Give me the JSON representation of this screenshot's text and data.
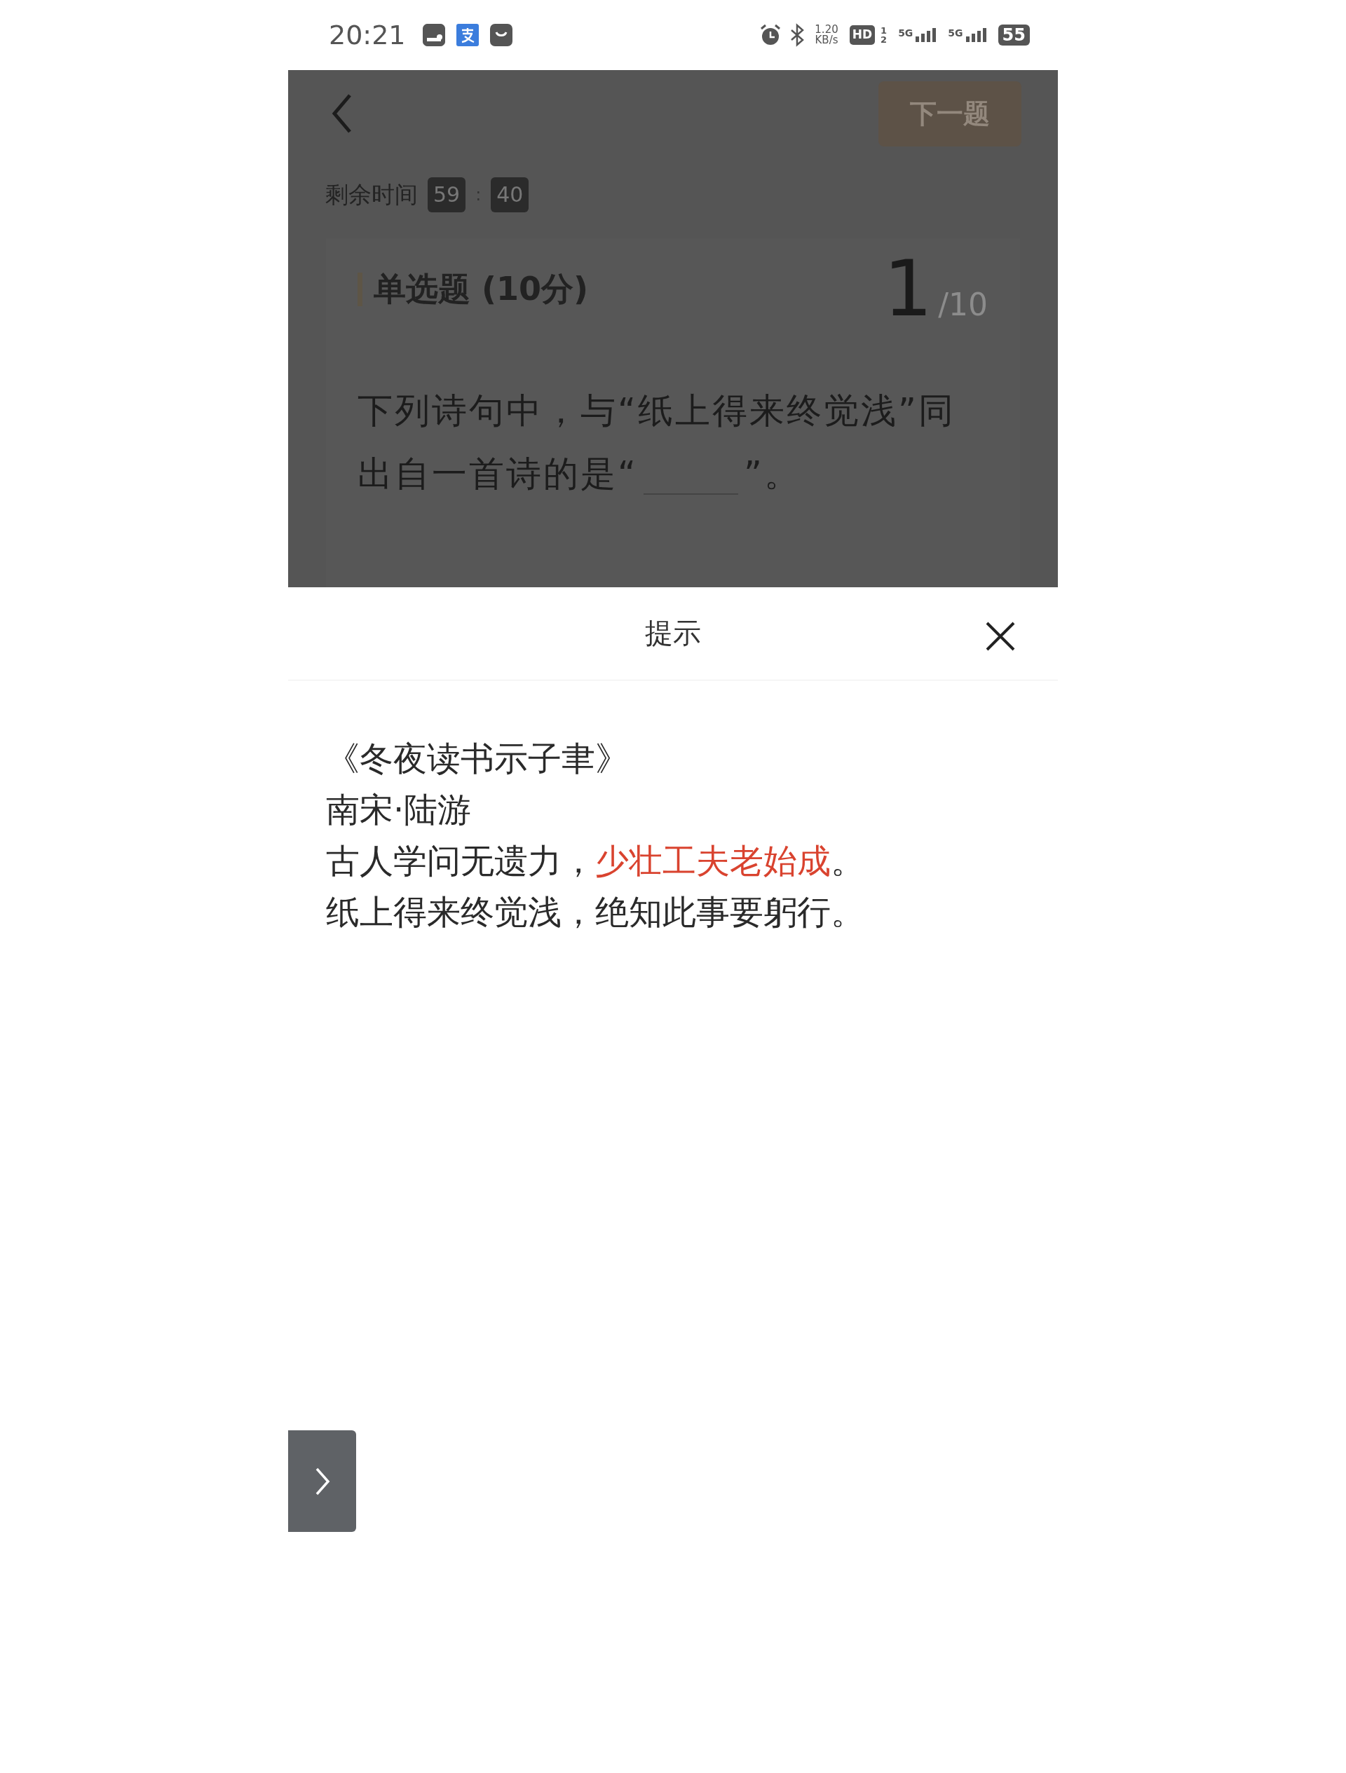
{
  "status_bar": {
    "time": "20:21",
    "speed_value": "1.20",
    "speed_unit": "KB/s",
    "hd_label": "HD",
    "sim_labels": [
      "1",
      "2"
    ],
    "networks": [
      "5G",
      "5G"
    ],
    "battery": "55"
  },
  "header": {
    "next_button": "下一题"
  },
  "timer": {
    "label": "剩余时间",
    "minutes": "59",
    "separator": ":",
    "seconds": "40"
  },
  "question": {
    "type": "单选题 (10分)",
    "number": "1",
    "total": "/10",
    "first_line": "下列诗句中，与“纸上得来终觉浅”同",
    "second_line": "出自一首诗的是“",
    "after_blank": "”。"
  },
  "hint": {
    "title": "提示",
    "lines": [
      {
        "segments": [
          {
            "text": "《冬夜读书示子聿》",
            "highlighted": false
          }
        ]
      },
      {
        "segments": [
          {
            "text": "南宋·陆游",
            "highlighted": false
          }
        ]
      },
      {
        "segments": [
          {
            "text": "古人学问无遗力，",
            "highlighted": false
          },
          {
            "text": "少壮工夫老始成",
            "highlighted": true
          },
          {
            "text": "。",
            "highlighted": false
          }
        ]
      },
      {
        "segments": [
          {
            "text": "纸上得来终觉浅，绝知此事要躬行。",
            "highlighted": false
          }
        ]
      }
    ]
  }
}
